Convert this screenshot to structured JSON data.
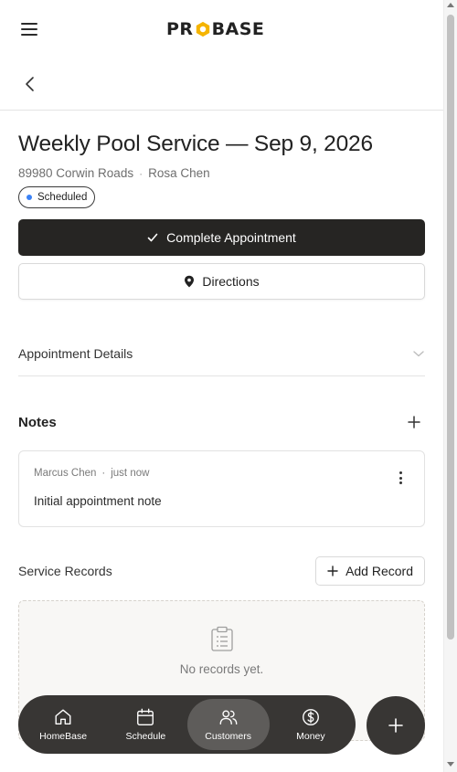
{
  "header": {
    "logo_left": "PR",
    "logo_right": "BASE",
    "brand_color": "#F5B400"
  },
  "appointment": {
    "title": "Weekly Pool Service — Sep 9, 2026",
    "address": "89980 Corwin Roads",
    "separator": "·",
    "customer": "Rosa Chen",
    "status": "Scheduled",
    "status_color": "#3B82F6"
  },
  "actions": {
    "complete_label": "Complete Appointment",
    "directions_label": "Directions"
  },
  "details": {
    "label": "Appointment Details"
  },
  "notes": {
    "label": "Notes",
    "items": [
      {
        "author": "Marcus Chen",
        "separator": "·",
        "time": "just now",
        "text": "Initial appointment note"
      }
    ]
  },
  "records": {
    "label": "Service Records",
    "add_label": "Add Record",
    "empty_text": "No records yet."
  },
  "nav": {
    "items": [
      {
        "label": "HomeBase",
        "icon": "home-icon"
      },
      {
        "label": "Schedule",
        "icon": "calendar-icon"
      },
      {
        "label": "Customers",
        "icon": "users-icon",
        "active": true
      },
      {
        "label": "Money",
        "icon": "dollar-icon"
      }
    ],
    "fab_icon": "plus-icon"
  }
}
